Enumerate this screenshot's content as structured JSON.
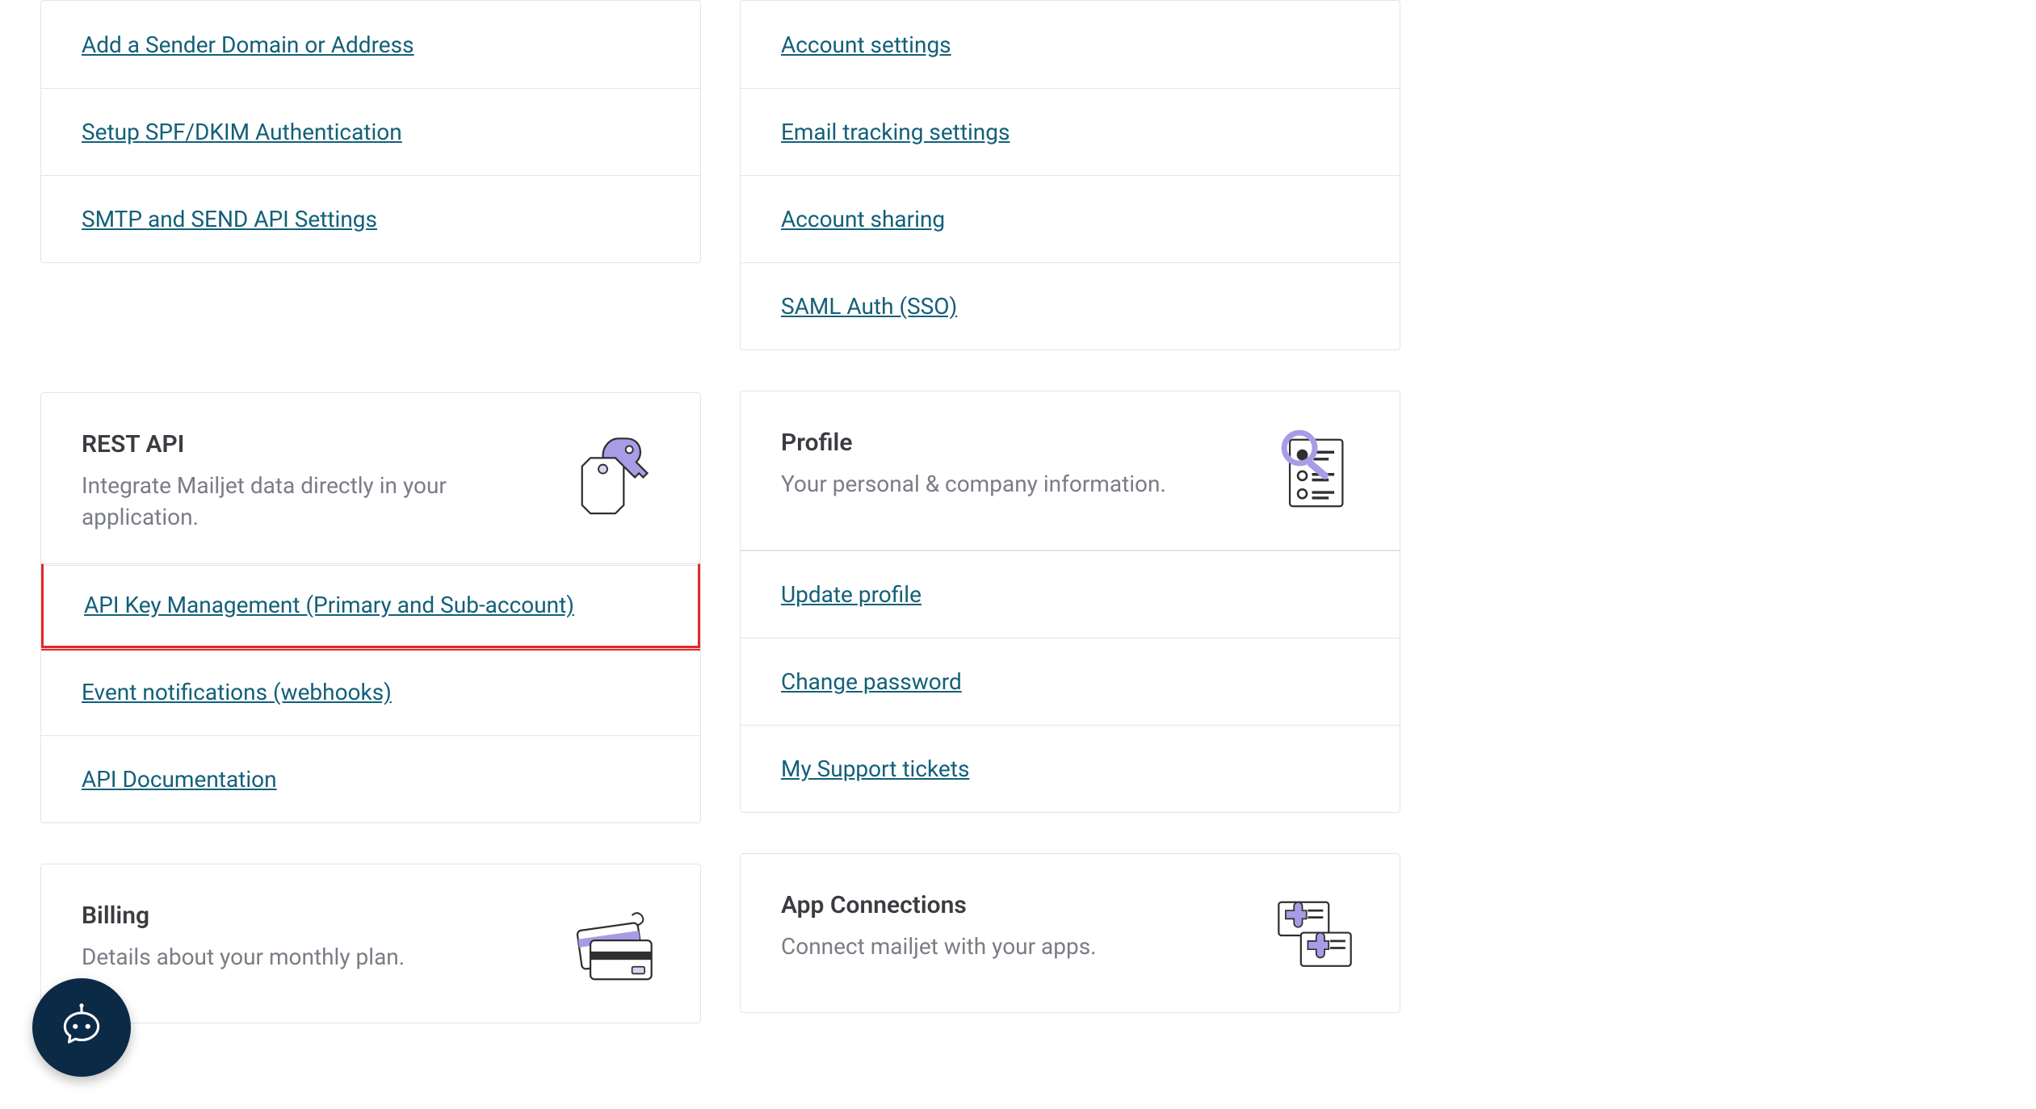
{
  "colors": {
    "link": "#136079",
    "border": "#e2e4e8",
    "highlight": "#e52828",
    "chat_btn_bg": "#0b2a46",
    "accent_purple": "#a99be5"
  },
  "left_col": {
    "top_links": [
      "Add a Sender Domain or Address",
      "Setup SPF/DKIM Authentication",
      "SMTP and SEND API Settings"
    ],
    "rest_api": {
      "title": "REST API",
      "desc": "Integrate Mailjet data directly in your application.",
      "links": [
        "API Key Management (Primary and Sub-account)",
        "Event notifications (webhooks)",
        "API Documentation"
      ],
      "highlighted_index": 0
    },
    "billing": {
      "title": "Billing",
      "desc": "Details about your monthly plan."
    }
  },
  "right_col": {
    "top_links": [
      "Account settings",
      "Email tracking settings",
      "Account sharing",
      "SAML Auth (SSO)"
    ],
    "profile": {
      "title": "Profile",
      "desc": "Your personal & company information.",
      "links": [
        "Update profile",
        "Change password",
        "My Support tickets"
      ]
    },
    "app_connections": {
      "title": "App Connections",
      "desc": "Connect mailjet with your apps."
    }
  },
  "chat_button_label": "Open chat"
}
